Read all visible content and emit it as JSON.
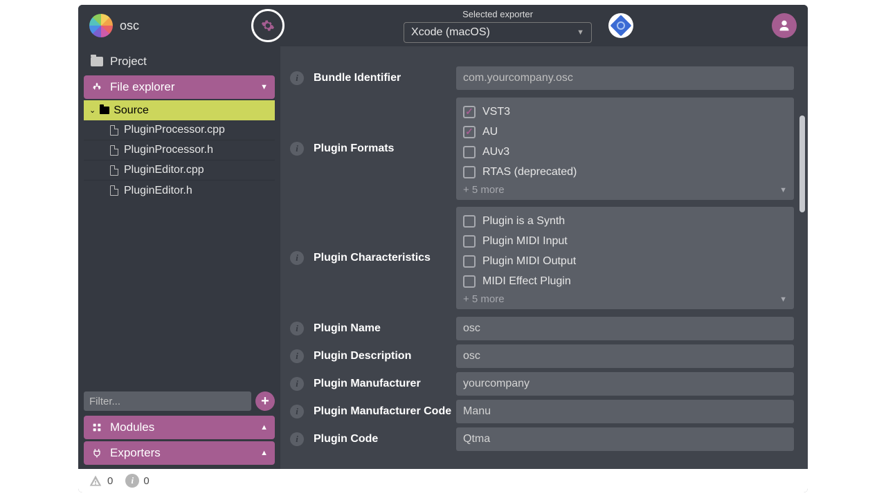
{
  "header": {
    "project_name": "osc",
    "exporter_label": "Selected exporter",
    "exporter_value": "Xcode (macOS)"
  },
  "sidebar": {
    "project_label": "Project",
    "file_explorer_label": "File explorer",
    "source_label": "Source",
    "files": [
      "PluginProcessor.cpp",
      "PluginProcessor.h",
      "PluginEditor.cpp",
      "PluginEditor.h"
    ],
    "filter_placeholder": "Filter...",
    "modules_label": "Modules",
    "exporters_label": "Exporters"
  },
  "form": {
    "bundle_id": {
      "label": "Bundle Identifier",
      "placeholder": "com.yourcompany.osc"
    },
    "plugin_formats": {
      "label": "Plugin Formats",
      "options": [
        {
          "label": "VST3",
          "checked": true
        },
        {
          "label": "AU",
          "checked": true
        },
        {
          "label": "AUv3",
          "checked": false
        },
        {
          "label": "RTAS (deprecated)",
          "checked": false
        }
      ],
      "more": "+ 5 more"
    },
    "plugin_characteristics": {
      "label": "Plugin Characteristics",
      "options": [
        {
          "label": "Plugin is a Synth",
          "checked": false
        },
        {
          "label": "Plugin MIDI Input",
          "checked": false
        },
        {
          "label": "Plugin MIDI Output",
          "checked": false
        },
        {
          "label": "MIDI Effect Plugin",
          "checked": false
        }
      ],
      "more": "+ 5 more"
    },
    "plugin_name": {
      "label": "Plugin Name",
      "value": "osc"
    },
    "plugin_description": {
      "label": "Plugin Description",
      "value": "osc"
    },
    "plugin_manufacturer": {
      "label": "Plugin Manufacturer",
      "value": "yourcompany"
    },
    "plugin_manufacturer_code": {
      "label": "Plugin Manufacturer Code",
      "value": "Manu"
    },
    "plugin_code": {
      "label": "Plugin Code",
      "value": "Qtma"
    }
  },
  "footer": {
    "warnings": "0",
    "infos": "0"
  }
}
